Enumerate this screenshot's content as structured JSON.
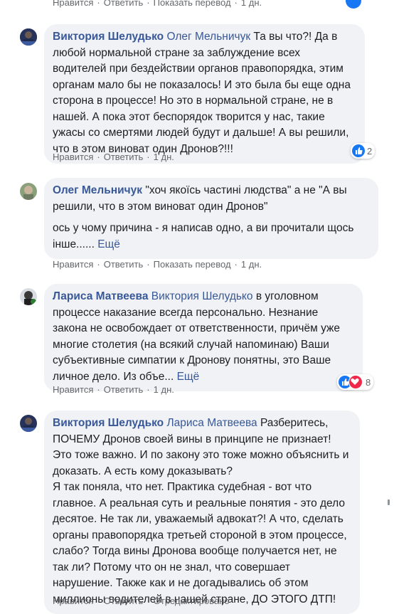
{
  "top": {
    "like": "Нравится",
    "reply": "Ответить",
    "translate": "Показать перевод",
    "time": "1 дн."
  },
  "comments": [
    {
      "author": "Виктория Шелудько",
      "mention": "Олег Мельничук",
      "text": " Та вы что?! Да в любой нормальной стране за заблуждение всех водителей при бездействии органов правопорядка, этим органам мало бы не показалось! И это была бы еще одна сторона в процессе! Но это в нормальной стране, не в нашей. А пока этот беспорядок творится у нас, такие ужасы со смертями людей будут и дальше! А вы решили, что в этом виноват один Дронов?!!!",
      "like": "Нравится",
      "reply": "Ответить",
      "time": "1 дн.",
      "reaction_count": "2"
    },
    {
      "author": "Олег Мельничук",
      "text1": " \"хоч якоїсь частині людства\" а не \"А вы решили, что в этом виноват один Дронов\"",
      "text2": "ось у чому причина - я написав одно, а ви прочитали щось інше......",
      "more": "Ещё",
      "like": "Нравится",
      "reply": "Ответить",
      "translate": "Показать перевод",
      "time": "1 дн."
    },
    {
      "author": "Лариса Матвеева",
      "mention": "Виктория Шелудько",
      "text": " в уголовном процессе наказание всегда персонально. Незнание закона не освобождает от ответственности, причём уже многие столетия (на всякий случай напоминаю) Ваши субъективные симпатии к Дронову понятны, это Ваше личное дело. Из объе...",
      "more": "Ещё",
      "like": "Нравится",
      "reply": "Ответить",
      "time": "1 дн.",
      "reaction_count": "8"
    },
    {
      "author": "Виктория Шелудько",
      "mention": "Лариса Матвеева",
      "text": " Разберитесь, ПОЧЕМУ Дронов своей вины в принципе не признает! Это тоже важно. И по закону это тоже можно объяснить и доказать. А есть кому доказывать?",
      "text2": "Я так поняла, что нет. Практика судебная - вот что главное. А реальная суть и реальные понятия - это дело десятое. Не так ли, уважаемый адвокат?! А что, сделать органы правопорядка третьей стороной в этом процессе, слабо? Тогда вины Дронова вообще получается нет, не так ли? Потому что он не знал, что совершает нарушение. Также как и не догадывались об этом миллионы водителей в нашей стране, ДО ЭТОГО ДТП!",
      "like": "Нравится",
      "reply": "Ответить",
      "edited": "Отредактировано"
    }
  ],
  "colors": {
    "name": "#385898",
    "bubble": "#f0f2f5",
    "meta": "#65676b",
    "like": "#1877f2",
    "love": "#f0284a"
  }
}
